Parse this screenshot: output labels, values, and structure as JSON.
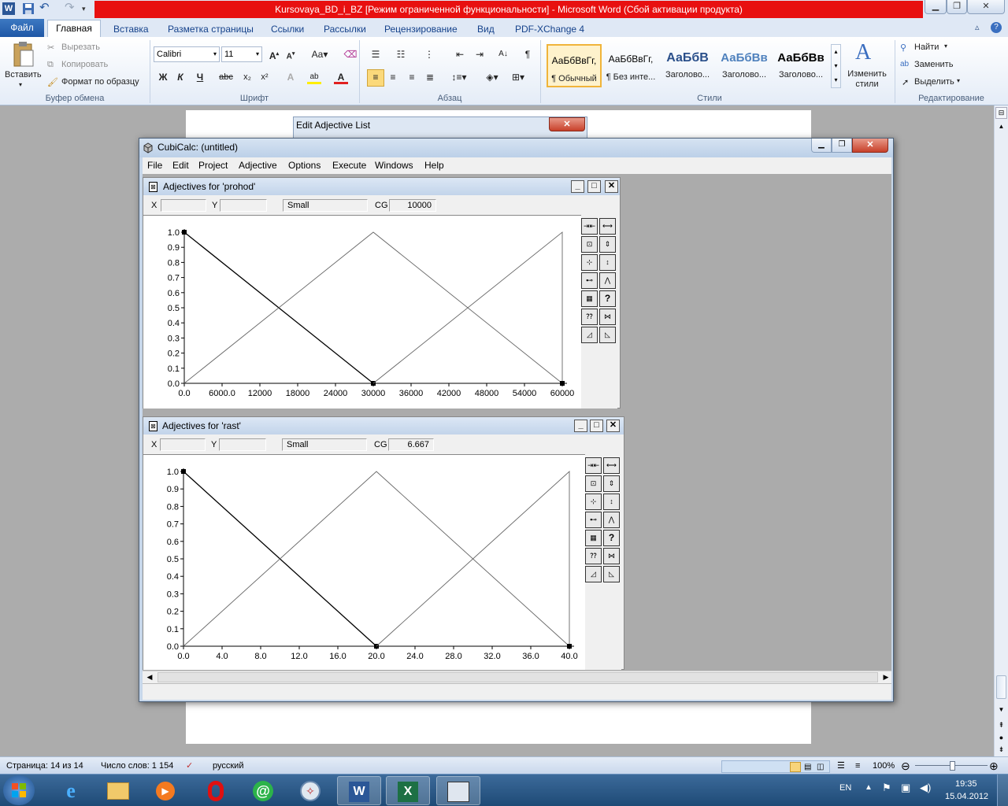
{
  "word": {
    "title": "Kursovaya_BD_i_BZ [Режим ограниченной функциональности] - Microsoft Word (Сбой активации продукта)",
    "tabs": {
      "file": "Файл",
      "home": "Главная",
      "insert": "Вставка",
      "layout": "Разметка страницы",
      "refs": "Ссылки",
      "mailings": "Рассылки",
      "review": "Рецензирование",
      "view": "Вид",
      "pdf": "PDF-XChange 4"
    },
    "clipboard": {
      "paste": "Вставить",
      "cut": "Вырезать",
      "copy": "Копировать",
      "format_painter": "Формат по образцу",
      "label": "Буфер обмена"
    },
    "font": {
      "name": "Calibri",
      "size": "11",
      "label": "Шрифт"
    },
    "paragraph": {
      "label": "Абзац"
    },
    "styles": {
      "label": "Стили",
      "items": [
        {
          "preview": "АаБбВвГг,",
          "name": "¶ Обычный"
        },
        {
          "preview": "АаБбВвГг,",
          "name": "¶ Без инте..."
        },
        {
          "preview": "АаБбВ",
          "name": "Заголово..."
        },
        {
          "preview": "АаБбВв",
          "name": "Заголово..."
        },
        {
          "preview": "АаБбВв",
          "name": "Заголово..."
        }
      ],
      "change_label": "Изменить стили"
    },
    "editing": {
      "find": "Найти",
      "replace": "Заменить",
      "select": "Выделить",
      "label": "Редактирование"
    },
    "status": {
      "page": "Страница: 14 из 14",
      "words": "Число слов: 1 154",
      "language": "русский",
      "zoom": "100%"
    }
  },
  "edit_adjective_list": {
    "title": "Edit Adjective List"
  },
  "cubicalc": {
    "title": "CubiCalc: (untitled)",
    "menu": [
      "File",
      "Edit",
      "Project",
      "Adjective",
      "Options",
      "Execute",
      "Windows",
      "Help"
    ],
    "panels": [
      {
        "title": "Adjectives for 'prohod'",
        "x_label": "X",
        "y_label": "Y",
        "adjective": "Small",
        "cg_label": "CG",
        "cg_value": "10000"
      },
      {
        "title": "Adjectives for 'rast'",
        "x_label": "X",
        "y_label": "Y",
        "adjective": "Small",
        "cg_label": "CG",
        "cg_value": "6.667"
      }
    ]
  },
  "chart_data": [
    {
      "type": "line",
      "x_ticks": [
        "0.0",
        "6000.0",
        "12000",
        "18000",
        "24000",
        "30000",
        "36000",
        "42000",
        "48000",
        "54000",
        "60000"
      ],
      "y_ticks": [
        "0.0",
        "0.1",
        "0.2",
        "0.3",
        "0.4",
        "0.5",
        "0.6",
        "0.7",
        "0.8",
        "0.9",
        "1.0"
      ],
      "xlim": [
        0,
        60000
      ],
      "ylim": [
        0,
        1
      ],
      "series": [
        {
          "x": [
            0,
            30000
          ],
          "y": [
            1,
            0
          ],
          "selected": true
        },
        {
          "x": [
            0,
            30000,
            60000
          ],
          "y": [
            0,
            1,
            0
          ]
        },
        {
          "x": [
            30000,
            60000,
            60000
          ],
          "y": [
            0,
            1,
            0
          ]
        }
      ]
    },
    {
      "type": "line",
      "x_ticks": [
        "0.0",
        "4.0",
        "8.0",
        "12.0",
        "16.0",
        "20.0",
        "24.0",
        "28.0",
        "32.0",
        "36.0",
        "40.0"
      ],
      "y_ticks": [
        "0.0",
        "0.1",
        "0.2",
        "0.3",
        "0.4",
        "0.5",
        "0.6",
        "0.7",
        "0.8",
        "0.9",
        "1.0"
      ],
      "xlim": [
        0,
        40
      ],
      "ylim": [
        0,
        1
      ],
      "series": [
        {
          "x": [
            0,
            20
          ],
          "y": [
            1,
            0
          ],
          "selected": true
        },
        {
          "x": [
            0,
            20,
            40
          ],
          "y": [
            0,
            1,
            0
          ]
        },
        {
          "x": [
            20,
            40,
            40
          ],
          "y": [
            0,
            1,
            0
          ]
        }
      ]
    }
  ],
  "taskbar": {
    "lang": "EN",
    "time": "19:35",
    "date": "15.04.2012"
  }
}
